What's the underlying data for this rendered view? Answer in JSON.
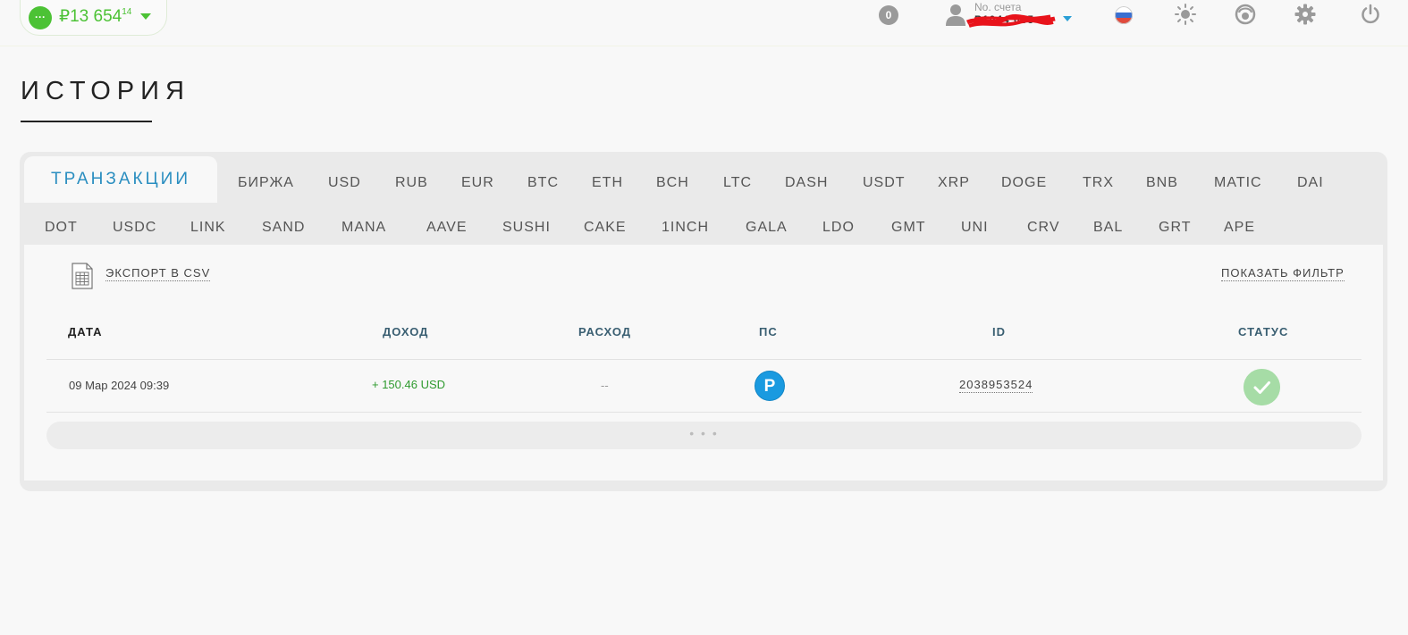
{
  "topbar": {
    "balance": {
      "menu_icon": "more-icon",
      "currency_symbol": "₽",
      "amount_main": "13 654",
      "amount_cents": "14",
      "caret_icon": "chevron-down-icon"
    },
    "notifications_count": "0",
    "account": {
      "label": "No. счета",
      "number": "P1044  085"
    },
    "icons": [
      "user-icon",
      "russia-flag-icon",
      "sun-icon",
      "support-icon",
      "gear-icon",
      "power-icon"
    ],
    "colors": {
      "brand_green": "#4cc235",
      "accent_blue": "#2a8ec0"
    }
  },
  "page": {
    "title": "ИСТОРИЯ"
  },
  "tabs": {
    "active": "ТРАНЗАКЦИИ",
    "row1": [
      "БИРЖА",
      "USD",
      "RUB",
      "EUR",
      "BTC",
      "ETH",
      "BCH",
      "LTC",
      "DASH",
      "USDT",
      "XRP",
      "DOGE",
      "TRX",
      "BNB",
      "MATIC",
      "DAI"
    ],
    "row2": [
      "DOT",
      "USDC",
      "LINK",
      "SAND",
      "MANA",
      "AAVE",
      "SUSHI",
      "CAKE",
      "1INCH",
      "GALA",
      "LDO",
      "GMT",
      "UNI",
      "CRV",
      "BAL",
      "GRT",
      "APE"
    ]
  },
  "toolbar": {
    "export_label": "ЭКСПОРТ В CSV",
    "filter_label": "ПОКАЗАТЬ ФИЛЬТР"
  },
  "table": {
    "headers": [
      "ДАТА",
      "ДОХОД",
      "РАСХОД",
      "ПС",
      "ID",
      "СТАТУС"
    ],
    "rows": [
      {
        "date": "09 Мар 2024 09:39",
        "income": "+ 150.46 USD",
        "expense": "--",
        "ps": "P",
        "id": "2038953524",
        "status_icon": "check-icon"
      }
    ],
    "more_label": "• • •"
  }
}
